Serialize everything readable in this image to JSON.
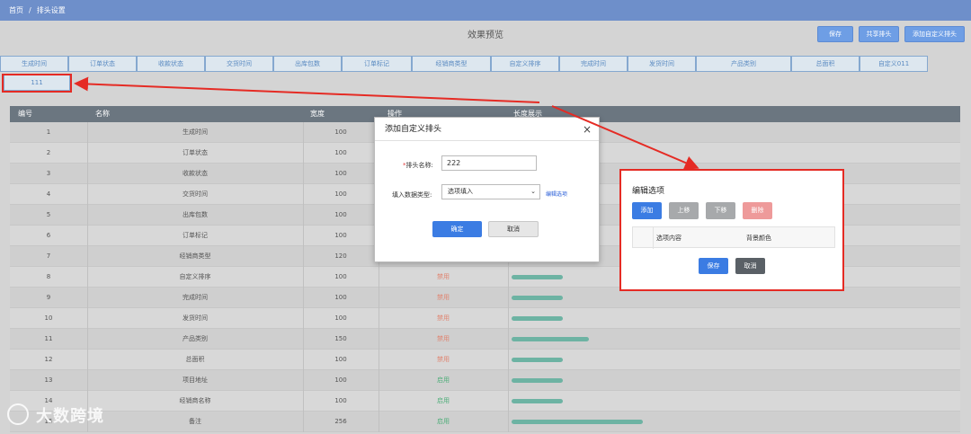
{
  "breadcrumb": {
    "home": "首页",
    "sep": "/",
    "current": "排头设置"
  },
  "preview_title": "效果预览",
  "actions": {
    "save": "保存",
    "share": "共享排头",
    "add_custom": "添加自定义排头"
  },
  "header_tabs": [
    "生成时间",
    "订单状态",
    "收款状态",
    "交货时间",
    "出库包数",
    "订单标记",
    "经销商类型",
    "自定义排序",
    "完成时间",
    "发货时间",
    "产品类别",
    "总面积",
    "自定义011"
  ],
  "custom_tab": "111",
  "table": {
    "headers": {
      "num": "编号",
      "name": "名称",
      "width": "宽度",
      "op": "操作",
      "bar": "长度展示"
    },
    "rows": [
      {
        "num": "1",
        "name": "生成时间",
        "width": "100",
        "op": ""
      },
      {
        "num": "2",
        "name": "订单状态",
        "width": "100",
        "op": ""
      },
      {
        "num": "3",
        "name": "收款状态",
        "width": "100",
        "op": ""
      },
      {
        "num": "4",
        "name": "交货时间",
        "width": "100",
        "op": ""
      },
      {
        "num": "5",
        "name": "出库包数",
        "width": "100",
        "op": ""
      },
      {
        "num": "6",
        "name": "订单标记",
        "width": "100",
        "op": ""
      },
      {
        "num": "7",
        "name": "经销商类型",
        "width": "120",
        "op": ""
      },
      {
        "num": "8",
        "name": "自定义排序",
        "width": "100",
        "op": "禁用"
      },
      {
        "num": "9",
        "name": "完成时间",
        "width": "100",
        "op": "禁用"
      },
      {
        "num": "10",
        "name": "发货时间",
        "width": "100",
        "op": "禁用"
      },
      {
        "num": "11",
        "name": "产品类别",
        "width": "150",
        "op": "禁用"
      },
      {
        "num": "12",
        "name": "总面积",
        "width": "100",
        "op": "禁用"
      },
      {
        "num": "13",
        "name": "项目地址",
        "width": "100",
        "op": "启用"
      },
      {
        "num": "14",
        "name": "经销商名称",
        "width": "100",
        "op": "启用"
      },
      {
        "num": "15",
        "name": "备注",
        "width": "256",
        "op": "启用"
      }
    ]
  },
  "modal": {
    "title": "添加自定义排头",
    "close": "×",
    "name_label": "排头名称:",
    "name_required": "*",
    "name_value": "222",
    "type_label": "填入数据类型:",
    "type_value": "选项填入",
    "edit_link": "编辑选项",
    "confirm": "确定",
    "cancel": "取消"
  },
  "edit_options": {
    "title": "编辑选项",
    "add": "添加",
    "up": "上移",
    "down": "下移",
    "delete": "删除",
    "col_content": "选项内容",
    "col_bg": "背景颜色",
    "save": "保存",
    "cancel": "取消"
  },
  "watermark": "大数跨境",
  "colors": {
    "topbar": "#6e8fca",
    "primary": "#3b7ce3",
    "bar": "#6db3a3",
    "red_annotation": "#e52b24",
    "disabled_text": "#e08470",
    "enabled_text": "#4fae7a"
  }
}
